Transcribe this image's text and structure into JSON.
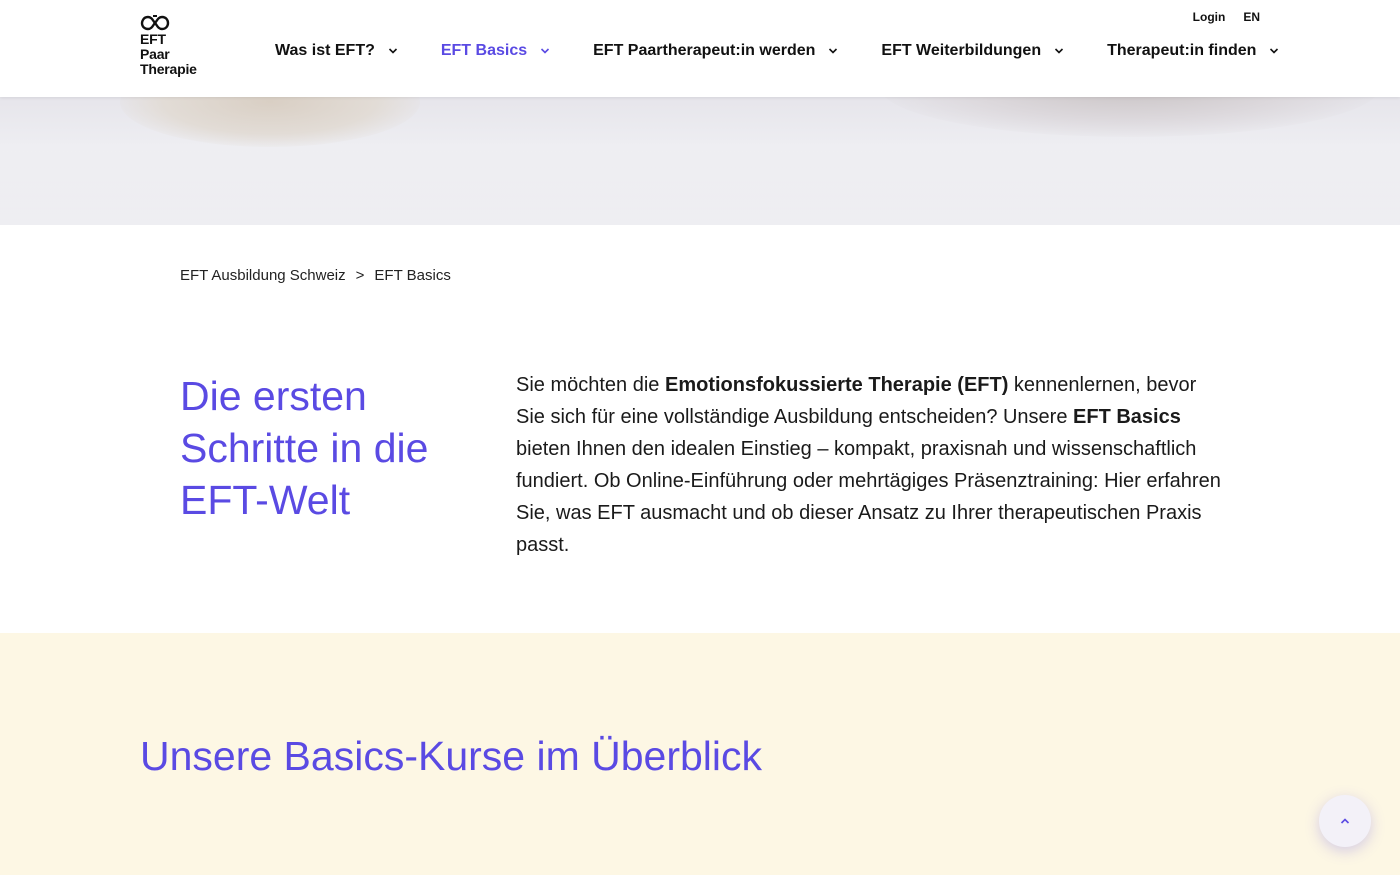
{
  "header": {
    "logo": {
      "line1": "EFT",
      "line2": "Paar",
      "line3": "Therapie"
    },
    "utility": {
      "login": "Login",
      "language": "EN"
    },
    "nav": [
      {
        "label": "Was ist EFT?",
        "active": false
      },
      {
        "label": "EFT Basics",
        "active": true
      },
      {
        "label": "EFT Paartherapeut:in werden",
        "active": false
      },
      {
        "label": "EFT Weiterbildungen",
        "active": false
      },
      {
        "label": "Therapeut:in finden",
        "active": false
      }
    ]
  },
  "breadcrumb": {
    "parent": "EFT Ausbildung Schweiz",
    "separator": ">",
    "current": "EFT Basics"
  },
  "intro": {
    "title": "Die ersten Schritte in die EFT-Welt",
    "text_parts": {
      "p1": "Sie möchten die ",
      "b1": "Emotionsfokussierte Therapie (EFT)",
      "p2": " kennenlernen, bevor Sie sich für eine vollständige Ausbildung entscheiden? Unsere ",
      "b2": "EFT Basics",
      "p3": " bieten Ihnen den idealen Einstieg – kompakt, praxisnah und wissenschaftlich fundiert. Ob Online-Einführung oder mehrtägiges Präsenztraining: Hier erfahren Sie, was EFT ausmacht und ob dieser Ansatz zu Ihrer therapeutischen Praxis passt."
    }
  },
  "overview": {
    "heading": "Unsere Basics-Kurse im Überblick"
  },
  "icons": {
    "chevron": "chevron-down-icon",
    "back_to_top": "chevron-up-icon",
    "logo": "infinity-logo-icon"
  },
  "colors": {
    "accent": "#5a4ae3",
    "section_bg": "#fdf7e4"
  }
}
